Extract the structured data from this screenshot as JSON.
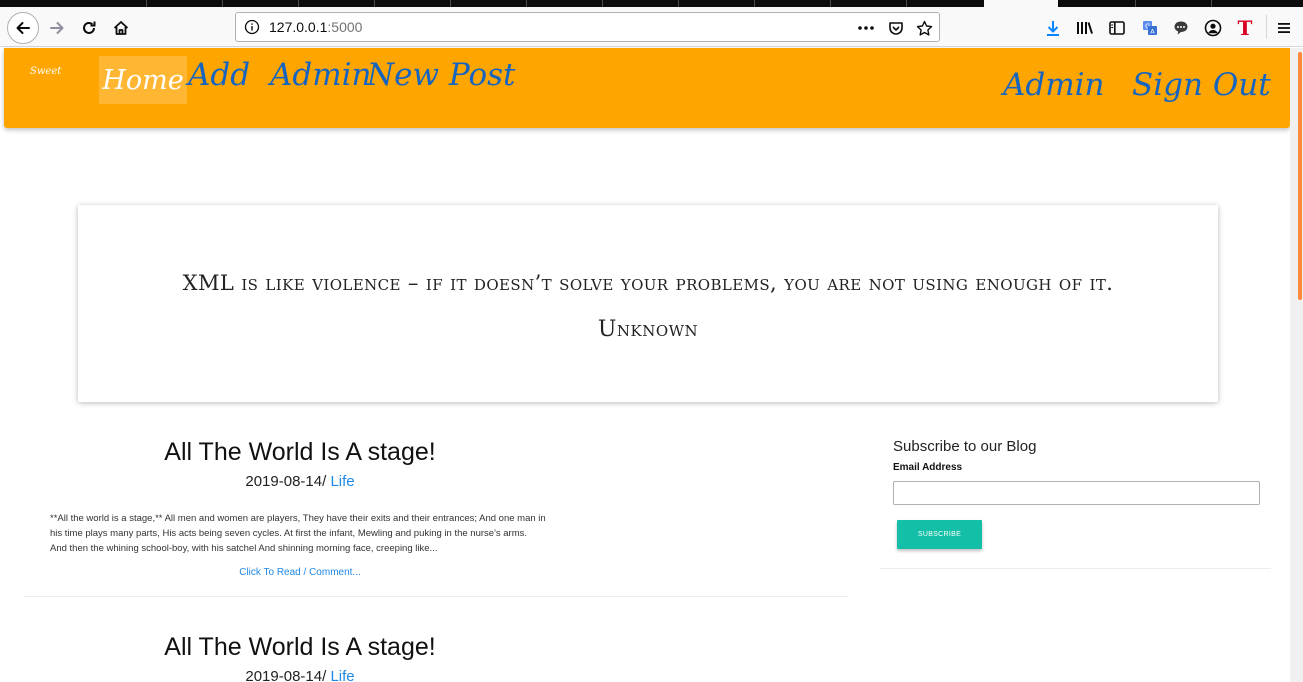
{
  "browser": {
    "url_host": "127.0.0.1",
    "url_port": ":5000",
    "icons": {
      "back": "back-arrow-icon",
      "forward": "forward-arrow-icon",
      "reload": "reload-icon",
      "home": "home-icon",
      "info": "info-icon",
      "more": "more-dots-icon",
      "pocket": "pocket-icon",
      "bookmark": "star-icon",
      "download": "download-icon",
      "library": "library-icon",
      "sidebar": "sidebar-icon",
      "translate": "translate-icon",
      "chat": "chat-icon",
      "account": "account-icon",
      "extension": "t-extension-icon",
      "menu": "hamburger-menu-icon"
    },
    "accent_download": "#0a84ff"
  },
  "site": {
    "brand": "Sweet",
    "nav": {
      "home": "Home",
      "add_admin": "Add",
      "admin_link": "Admin",
      "new_post": "New Post",
      "admin_right": "Admin",
      "sign_out": "Sign Out"
    },
    "colors": {
      "nav_bg": "#ffa500",
      "nav_link": "#1565c0",
      "accent": "#13bfa6"
    }
  },
  "quote": {
    "text": "XML is like violence – if it doesn’t solve your problems, you are not using enough of it.",
    "author": "Unknown"
  },
  "posts": [
    {
      "title": "All The World Is A stage!",
      "date": "2019-08-14/",
      "category": "Life",
      "excerpt_lines": [
        "**All the world is a stage,** All men and women are players, They have their exits and their entrances; And one man in",
        "his time plays many parts, His acts being seven cycles. At first the infant, Mewling and puking in the nurse's arms.",
        "And then the whining school-boy, with his satchel And shinning morning face, creeping like..."
      ],
      "read_more": "Click To Read / Comment..."
    },
    {
      "title": "All The World Is A stage!",
      "date": "2019-08-14/",
      "category": "Life"
    }
  ],
  "subscribe": {
    "title": "Subscribe to our Blog",
    "email_label": "Email Address",
    "email_value": "",
    "button": "SUBSCRIBE"
  }
}
